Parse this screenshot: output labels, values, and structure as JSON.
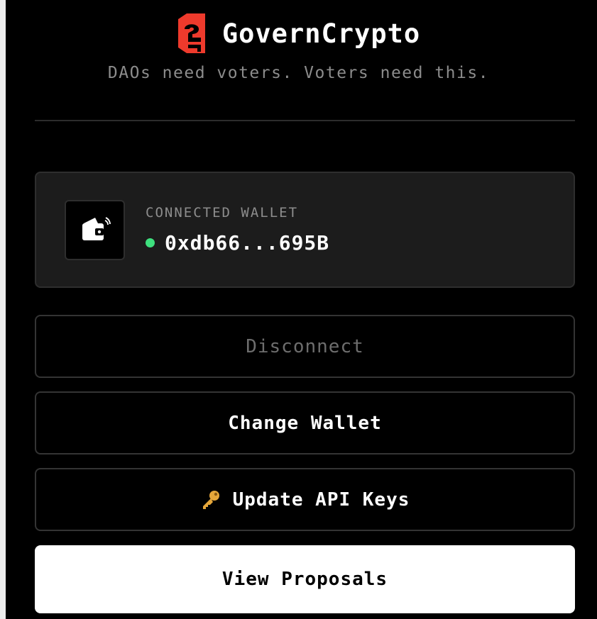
{
  "app": {
    "name": "GovernCrypto",
    "tagline": "DAOs need voters. Voters need this.",
    "logo_icon": "govern-logo-icon",
    "brand_color": "#ee3a2c"
  },
  "wallet": {
    "label": "CONNECTED WALLET",
    "address": "0xdb66...695B",
    "status": "connected",
    "status_color": "#3ee07e",
    "icon": "wallet-icon"
  },
  "actions": {
    "disconnect_label": "Disconnect",
    "change_wallet_label": "Change Wallet",
    "update_api_keys_label": "Update API Keys",
    "update_api_keys_icon": "key-icon",
    "view_proposals_label": "View Proposals"
  }
}
